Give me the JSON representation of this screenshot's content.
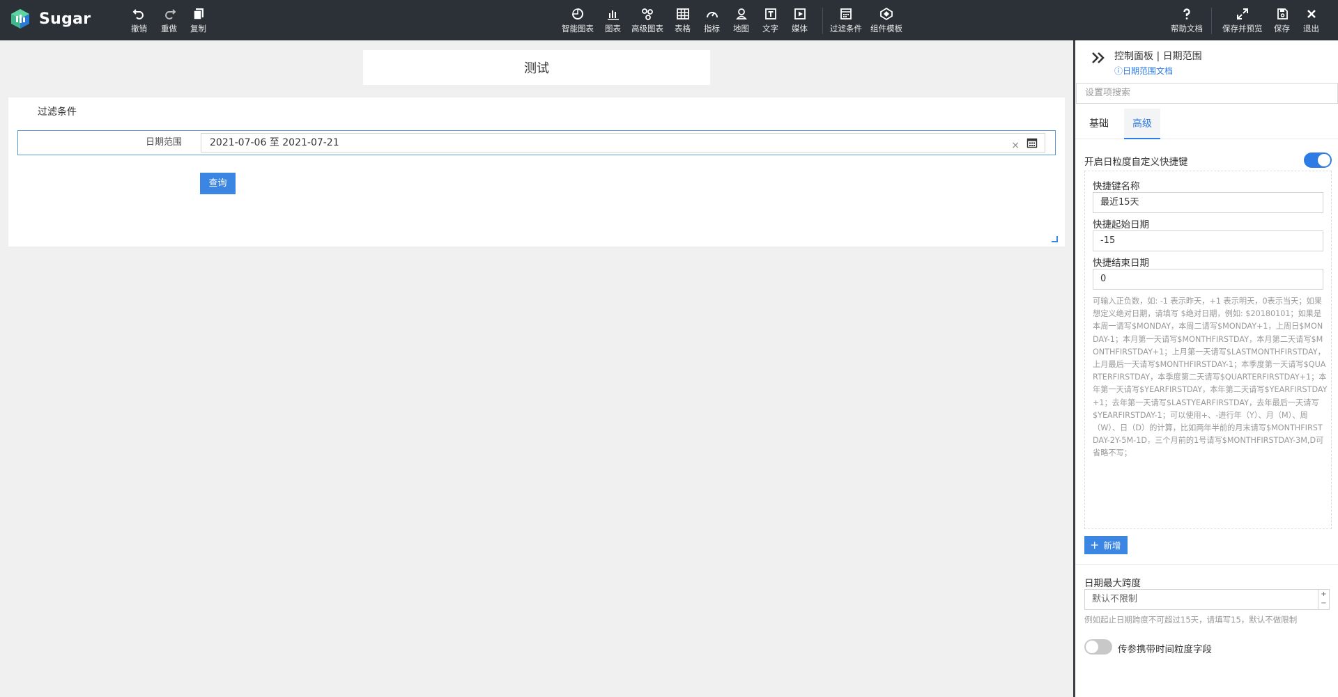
{
  "app": {
    "name": "Sugar"
  },
  "toolbar": {
    "left": [
      {
        "icon": "undo-icon",
        "label": "撤销"
      },
      {
        "icon": "redo-icon",
        "label": "重做"
      },
      {
        "icon": "copy-icon",
        "label": "复制"
      }
    ],
    "center": [
      {
        "icon": "smart-chart-icon",
        "label": "智能图表"
      },
      {
        "icon": "chart-icon",
        "label": "图表"
      },
      {
        "icon": "advanced-chart-icon",
        "label": "高级图表"
      },
      {
        "icon": "table-icon",
        "label": "表格"
      },
      {
        "icon": "gauge-icon",
        "label": "指标"
      },
      {
        "icon": "map-icon",
        "label": "地图"
      },
      {
        "icon": "text-icon",
        "label": "文字"
      },
      {
        "icon": "media-icon",
        "label": "媒体"
      },
      {
        "icon": "filter-icon",
        "label": "过滤条件"
      },
      {
        "icon": "template-icon",
        "label": "组件模板"
      }
    ],
    "right": [
      {
        "icon": "help-icon",
        "label": "帮助文档"
      },
      {
        "icon": "preview-icon",
        "label": "保存并预览"
      },
      {
        "icon": "save-icon",
        "label": "保存"
      },
      {
        "icon": "exit-icon",
        "label": "退出"
      }
    ]
  },
  "canvas": {
    "title": "测试",
    "filter": {
      "heading": "过滤条件",
      "field_label": "日期范围",
      "date_value": "2021-07-06 至 2021-07-21",
      "clear_glyph": "×",
      "query_label": "查询"
    }
  },
  "panel": {
    "title": "控制面板 | 日期范围",
    "doc_link": "ⓘ日期范围文档",
    "search_placeholder": "设置项搜索",
    "tabs": [
      "基础",
      "高级"
    ],
    "active_tab": "高级",
    "custom_shortcut_label": "开启日粒度自定义快捷键",
    "custom_shortcut_enabled": true,
    "shortcut": {
      "name_label": "快捷键名称",
      "name_value": "最近15天",
      "start_label": "快捷起始日期",
      "start_value": "-15",
      "end_label": "快捷结束日期",
      "end_value": "0",
      "help": "可输入正负数，如: -1 表示昨天，+1 表示明天，0表示当天；如果想定义绝对日期，请填写 $绝对日期，例如: $20180101；如果是本周一请写$MONDAY，本周二请写$MONDAY+1，上周日$MONDAY-1；本月第一天请写$MONTHFIRSTDAY，本月第二天请写$MONTHFIRSTDAY+1；上月第一天请写$LASTMONTHFIRSTDAY，上月最后一天请写$MONTHFIRSTDAY-1；本季度第一天请写$QUARTERFIRSTDAY，本季度第二天请写$QUARTERFIRSTDAY+1；本年第一天请写$YEARFIRSTDAY，本年第二天请写$YEARFIRSTDAY+1；去年第一天请写$LASTYEARFIRSTDAY，去年最后一天请写$YEARFIRSTDAY-1；可以使用+、-进行年（Y）、月（M）、周（W）、日（D）的计算，比如两年半前的月末请写$MONTHFIRSTDAY-2Y-5M-1D，三个月前的1号请写$MONTHFIRSTDAY-3M,D可省略不写；"
    },
    "add_label": "新增",
    "max_span_label": "日期最大跨度",
    "max_span_placeholder": "默认不限制",
    "max_span_hint": "例如起止日期跨度不可超过15天，请填写15，默认不做限制",
    "time_field_label": "传参携带时间粒度字段",
    "time_field_enabled": false
  },
  "colors": {
    "topbar": "#2b3137",
    "accent": "#2d7be5",
    "button": "#3b86e3"
  }
}
